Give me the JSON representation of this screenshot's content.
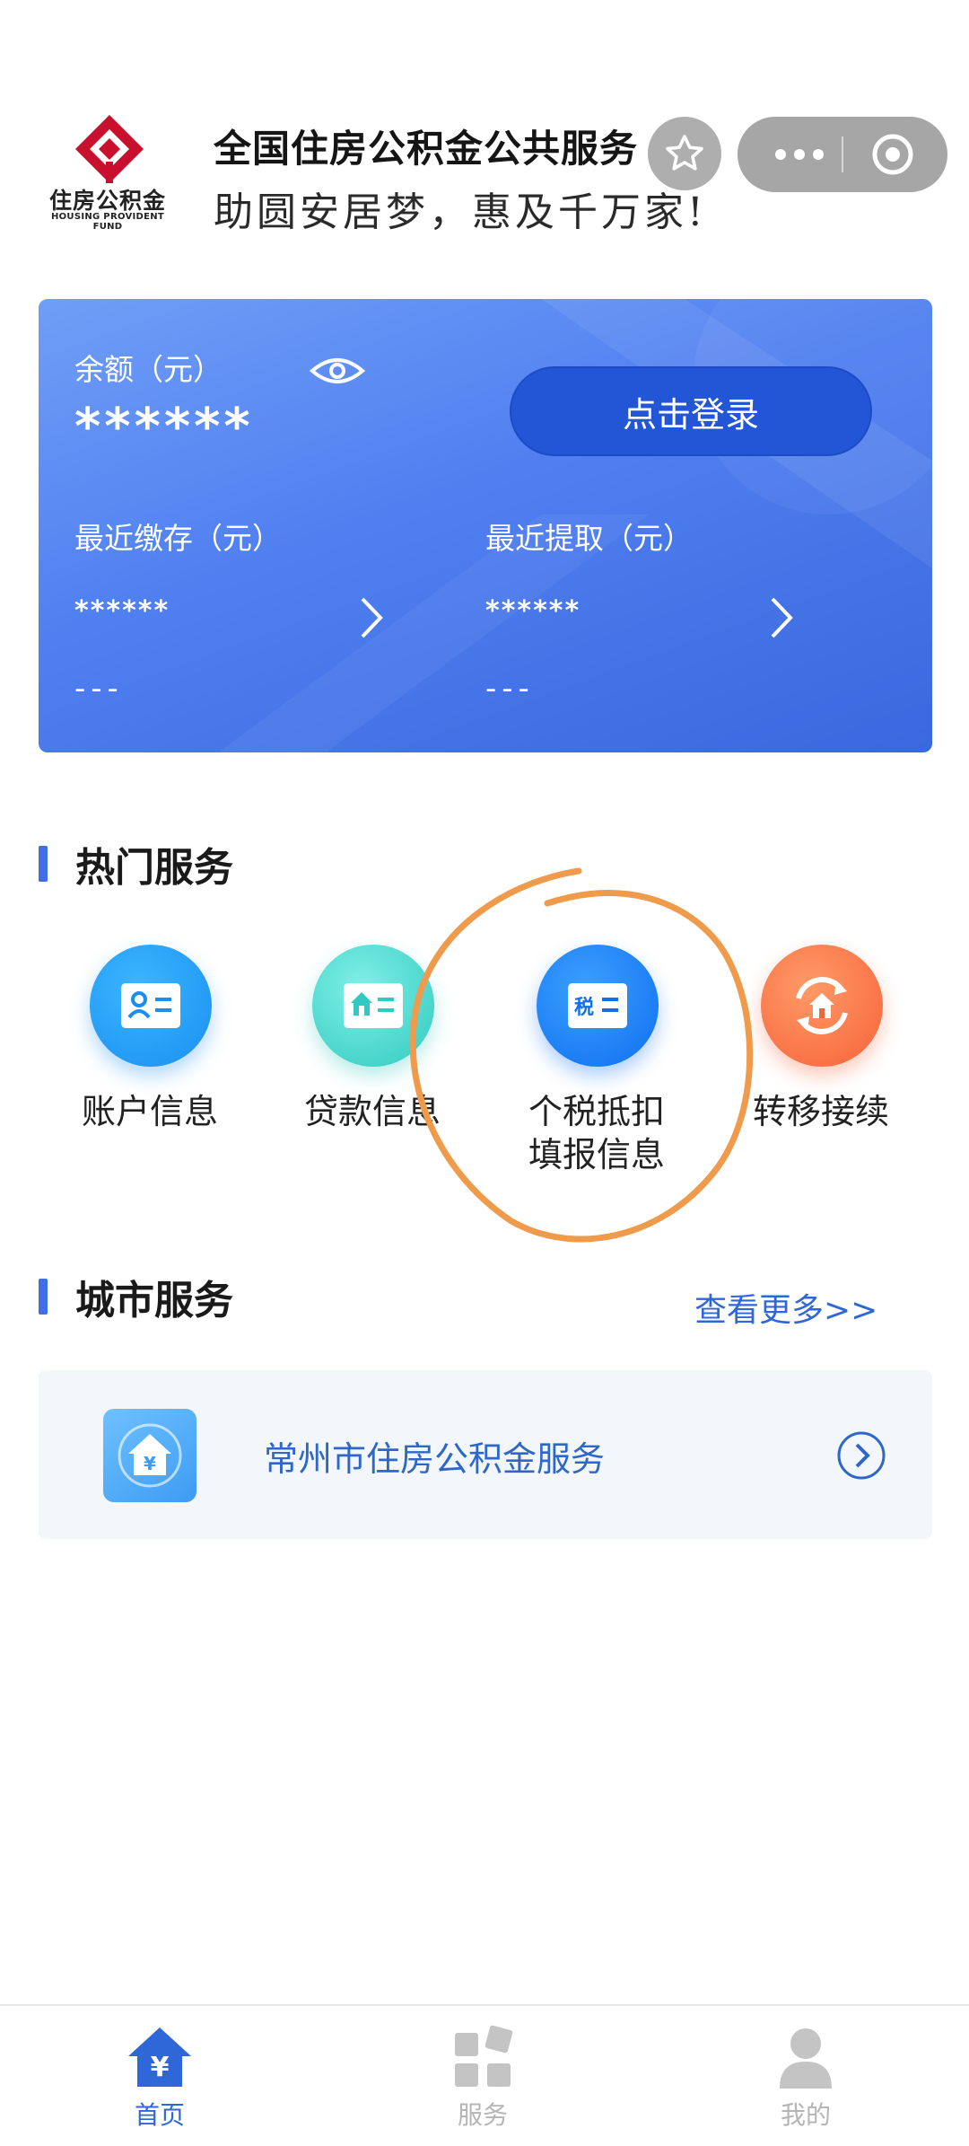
{
  "header": {
    "logo_cn": "住房公积金",
    "logo_en": "HOUSING PROVIDENT FUND",
    "title": "全国住房公积金公共服务",
    "slogan": "助圆安居梦，惠及千万家!",
    "icons": [
      "favorite-star-icon",
      "more-dots-icon",
      "close-mini-program-icon"
    ]
  },
  "account": {
    "balance_label": "余额（元）",
    "balance_value": "******",
    "login_label": "点击登录",
    "deposit_label": "最近缴存（元）",
    "deposit_value": "******",
    "deposit_date": "---",
    "withdraw_label": "最近提取（元）",
    "withdraw_value": "******",
    "withdraw_date": "---"
  },
  "hot_services": {
    "title": "热门服务",
    "items": [
      {
        "label": "账户信息",
        "icon": "account-card-icon"
      },
      {
        "label": "贷款信息",
        "icon": "loan-house-icon"
      },
      {
        "label": "个税抵扣\n填报信息",
        "icon_text": "税",
        "icon": "tax-card-icon"
      },
      {
        "label": "转移接续",
        "icon": "transfer-house-icon"
      }
    ]
  },
  "city_services": {
    "title": "城市服务",
    "more_label": "查看更多>>",
    "items": [
      {
        "name": "常州市住房公积金服务",
        "icon": "city-fund-icon"
      }
    ]
  },
  "tabbar": {
    "items": [
      {
        "label": "首页",
        "active": true
      },
      {
        "label": "服务",
        "active": false
      },
      {
        "label": "我的",
        "active": false
      }
    ]
  },
  "colors": {
    "brand_blue": "#3e6fe6",
    "link_blue": "#2f67d8",
    "annotation_orange": "#f09a4c",
    "logo_red": "#c8102e"
  }
}
